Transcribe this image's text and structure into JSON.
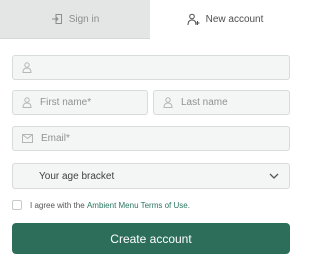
{
  "tabs": {
    "signin": {
      "label": "Sign in",
      "icon": "sign-in-icon"
    },
    "new_account": {
      "label": "New account",
      "icon": "new-account-icon"
    }
  },
  "form": {
    "top_field": {
      "icon": "user-icon",
      "placeholder": "",
      "value": ""
    },
    "first_name": {
      "icon": "user-icon",
      "placeholder": "First name*",
      "value": ""
    },
    "last_name": {
      "icon": "user-icon",
      "placeholder": "Last name",
      "value": ""
    },
    "email": {
      "icon": "envelope-icon",
      "placeholder": "Email*",
      "value": ""
    },
    "age_bracket": {
      "label": "Your age bracket",
      "icon": "chevron-down-icon"
    },
    "agree": {
      "prefix": "I agree with the ",
      "link": "Ambient Menu Terms of Use.",
      "checked": false
    },
    "submit_label": "Create account"
  },
  "colors": {
    "accent": "#2d6e5b",
    "link": "#2a7560",
    "inactive_tab": "#e4e6e6"
  }
}
